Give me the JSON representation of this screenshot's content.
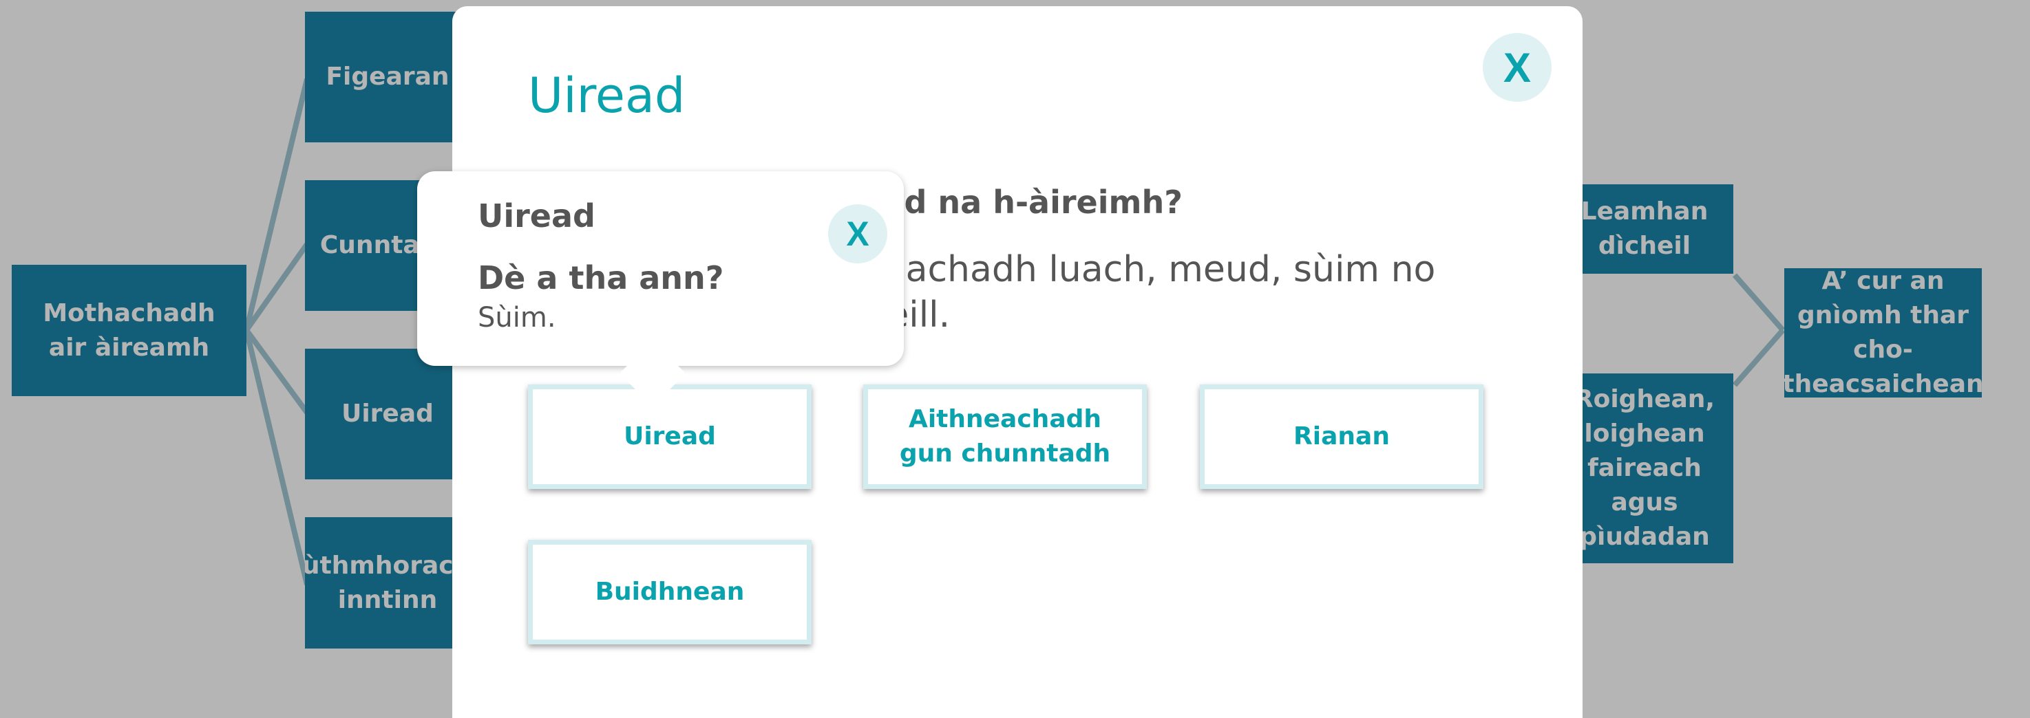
{
  "concept_map": {
    "root": "Mothachadh air àireamh",
    "branches_left": [
      "Figearan",
      "Cunntadh",
      "Uiread",
      "Lùthmhorachd inntinn"
    ],
    "branches_right": [
      "Leamhan dìcheil",
      "Roighean, loighean faireach agus pìudadan"
    ],
    "right_node": "A’ cur an gnìomh thar cho-theacsaichean"
  },
  "modal": {
    "title": "Uiread",
    "question": "Dè a th’ ann an uiread na h-àireimh?",
    "answer": "Bidh uiread a’ comasachadh luach, meud, sùim no àireamh a chur an cèill.",
    "close_label": "X",
    "buttons": [
      "Uiread",
      "Aithneachadh gun chunntadh",
      "Rianan",
      "Buidhnean"
    ]
  },
  "tooltip": {
    "title": "Uiread",
    "question": "Dè a tha ann?",
    "answer": "Sùim.",
    "close_label": "X"
  },
  "colors": {
    "node_blue": "#0c7ea4",
    "accent_teal": "#0aa3ad",
    "close_bg": "#dff1f2",
    "text_grey": "#555555"
  }
}
